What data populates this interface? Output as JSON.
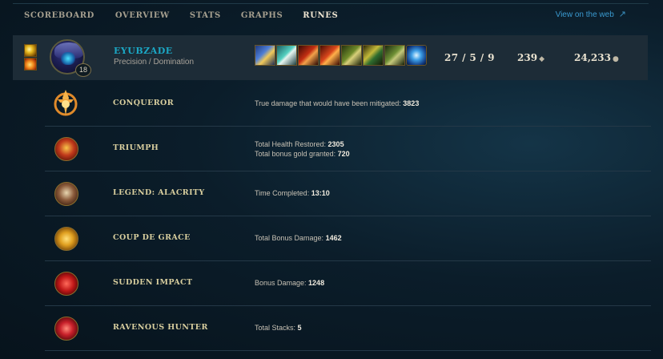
{
  "tabs": [
    {
      "label": "SCOREBOARD"
    },
    {
      "label": "OVERVIEW"
    },
    {
      "label": "STATS"
    },
    {
      "label": "GRAPHS"
    },
    {
      "label": "RUNES",
      "active": true
    }
  ],
  "view_web": {
    "label": "View on the web",
    "icon": "external-arrow-icon"
  },
  "player": {
    "name": "EYUBZADE",
    "runes": "Precision / Domination",
    "level": "18",
    "summoner_spells": [
      "flash",
      "ignite"
    ],
    "items": [
      "item-1",
      "item-2",
      "item-3",
      "item-4",
      "item-5",
      "item-6",
      "trinket"
    ],
    "kda": "27 / 5 / 9",
    "cs": "239",
    "gold": "24,233"
  },
  "runes": [
    {
      "name": "CONQUEROR",
      "stats": [
        {
          "label": "True damage that would have been mitigated: ",
          "value": "3823"
        }
      ]
    },
    {
      "name": "TRIUMPH",
      "stats": [
        {
          "label": "Total Health Restored: ",
          "value": "2305"
        },
        {
          "label": "Total bonus gold granted: ",
          "value": "720"
        }
      ]
    },
    {
      "name": "LEGEND: ALACRITY",
      "stats": [
        {
          "label": "Time Completed: ",
          "value": "13:10"
        }
      ]
    },
    {
      "name": "COUP DE GRACE",
      "stats": [
        {
          "label": "Total Bonus Damage: ",
          "value": "1462"
        }
      ]
    },
    {
      "name": "SUDDEN IMPACT",
      "stats": [
        {
          "label": "Bonus Damage: ",
          "value": "1248"
        }
      ]
    },
    {
      "name": "RAVENOUS HUNTER",
      "stats": [
        {
          "label": "Total Stacks: ",
          "value": "5"
        }
      ]
    }
  ],
  "colors": {
    "accent": "#1ba7c4",
    "rune_name": "#d8ce9e",
    "link": "#3a9ad0"
  }
}
